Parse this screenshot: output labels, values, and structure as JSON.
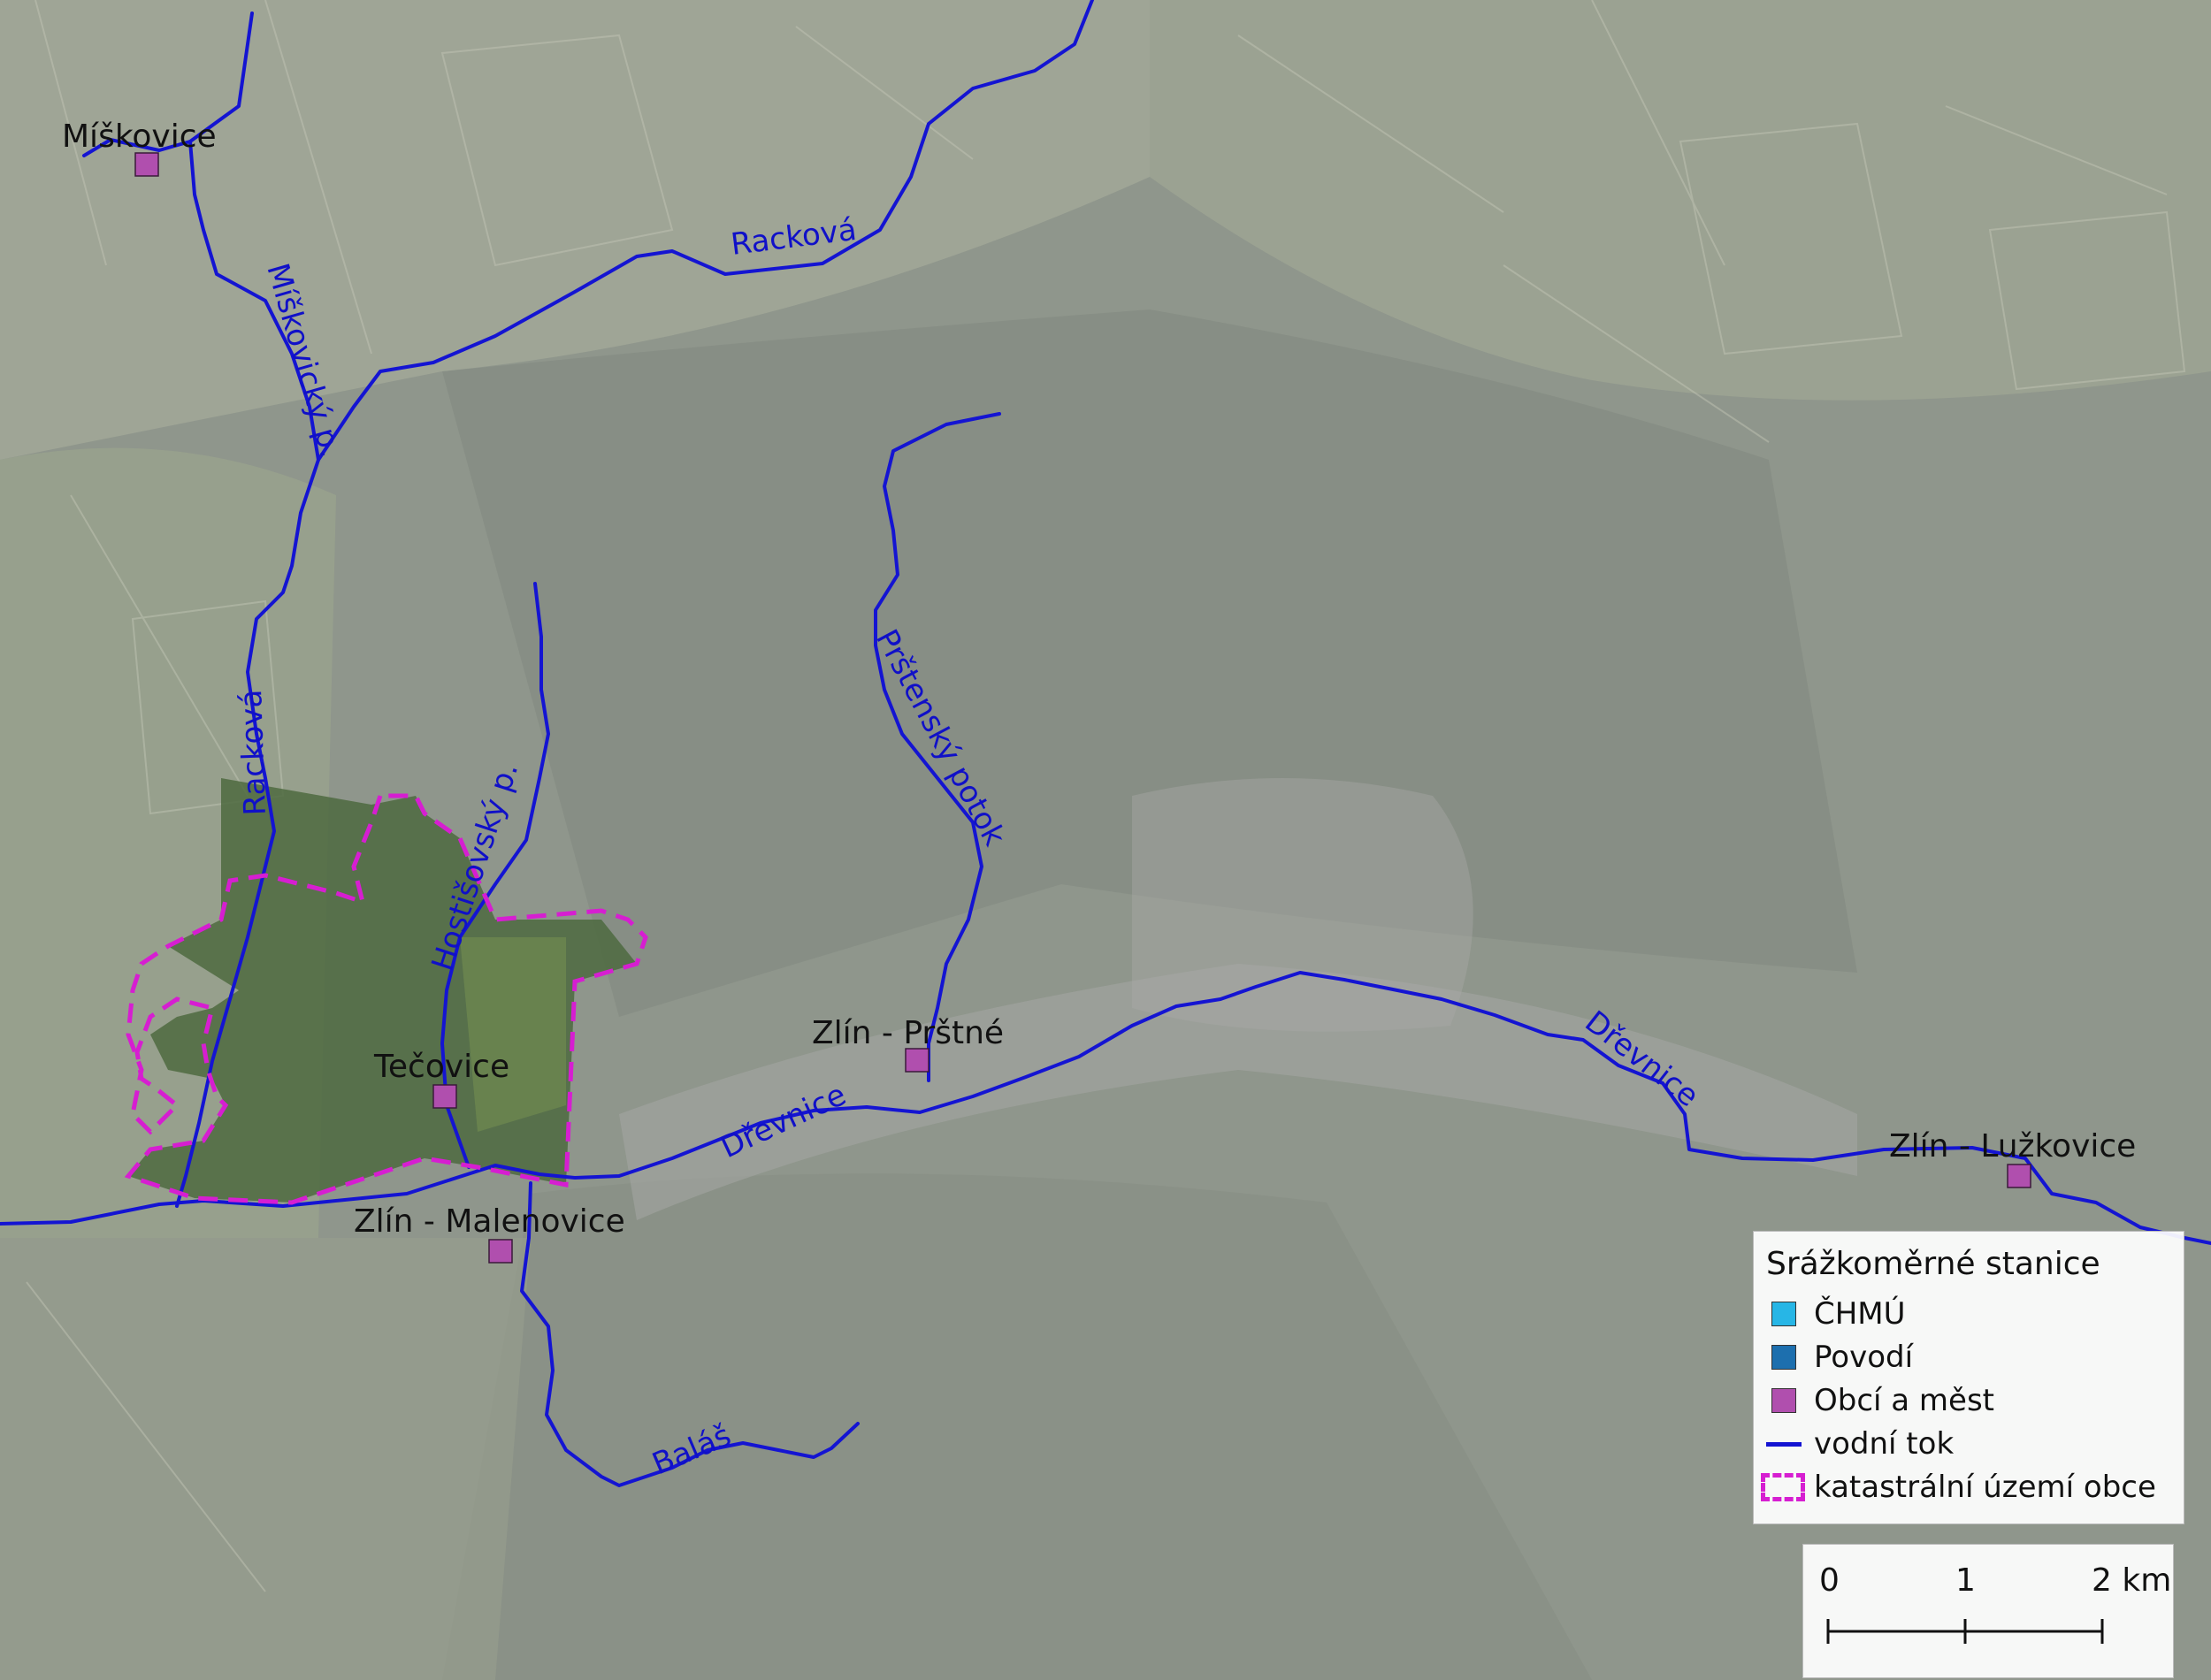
{
  "map": {
    "places": [
      {
        "id": "miskovice",
        "name": "Míškovice"
      },
      {
        "id": "tecovice",
        "name": "Tečovice"
      },
      {
        "id": "malenovice",
        "name": "Zlín - Malenovice"
      },
      {
        "id": "prstne",
        "name": "Zlín - Prštné"
      },
      {
        "id": "luzkovice",
        "name": "Zlín - Lužkovice"
      }
    ],
    "rivers": {
      "rackova_top": "Racková",
      "rackova_mid": "Racková",
      "miskovicky": "Míškovický p.",
      "hostisovsky": "Hostišovský p.",
      "prstensky": "Prštenský potok",
      "drevnice_1": "Dřevnice",
      "drevnice_2": "Dřevnice",
      "balas": "Baláš"
    }
  },
  "legend": {
    "title": "Srážkoměrné stanice",
    "items": [
      {
        "label": "ČHMÚ",
        "kind": "square",
        "color": "#27b6e6"
      },
      {
        "label": "Povodí",
        "kind": "square",
        "color": "#1d6fae"
      },
      {
        "label": "Obcí a měst",
        "kind": "square",
        "color": "#b04fae"
      },
      {
        "label": "vodní tok",
        "kind": "line",
        "color": "#1414d2"
      },
      {
        "label": "katastrální území obce",
        "kind": "dashed-box",
        "color": "#d61ed1"
      }
    ]
  },
  "scale_bar": {
    "labels": [
      "0",
      "1",
      "2 km"
    ]
  },
  "colors": {
    "river": "#1414d2",
    "boundary": "#d61ed1",
    "station": "#b04fae"
  }
}
